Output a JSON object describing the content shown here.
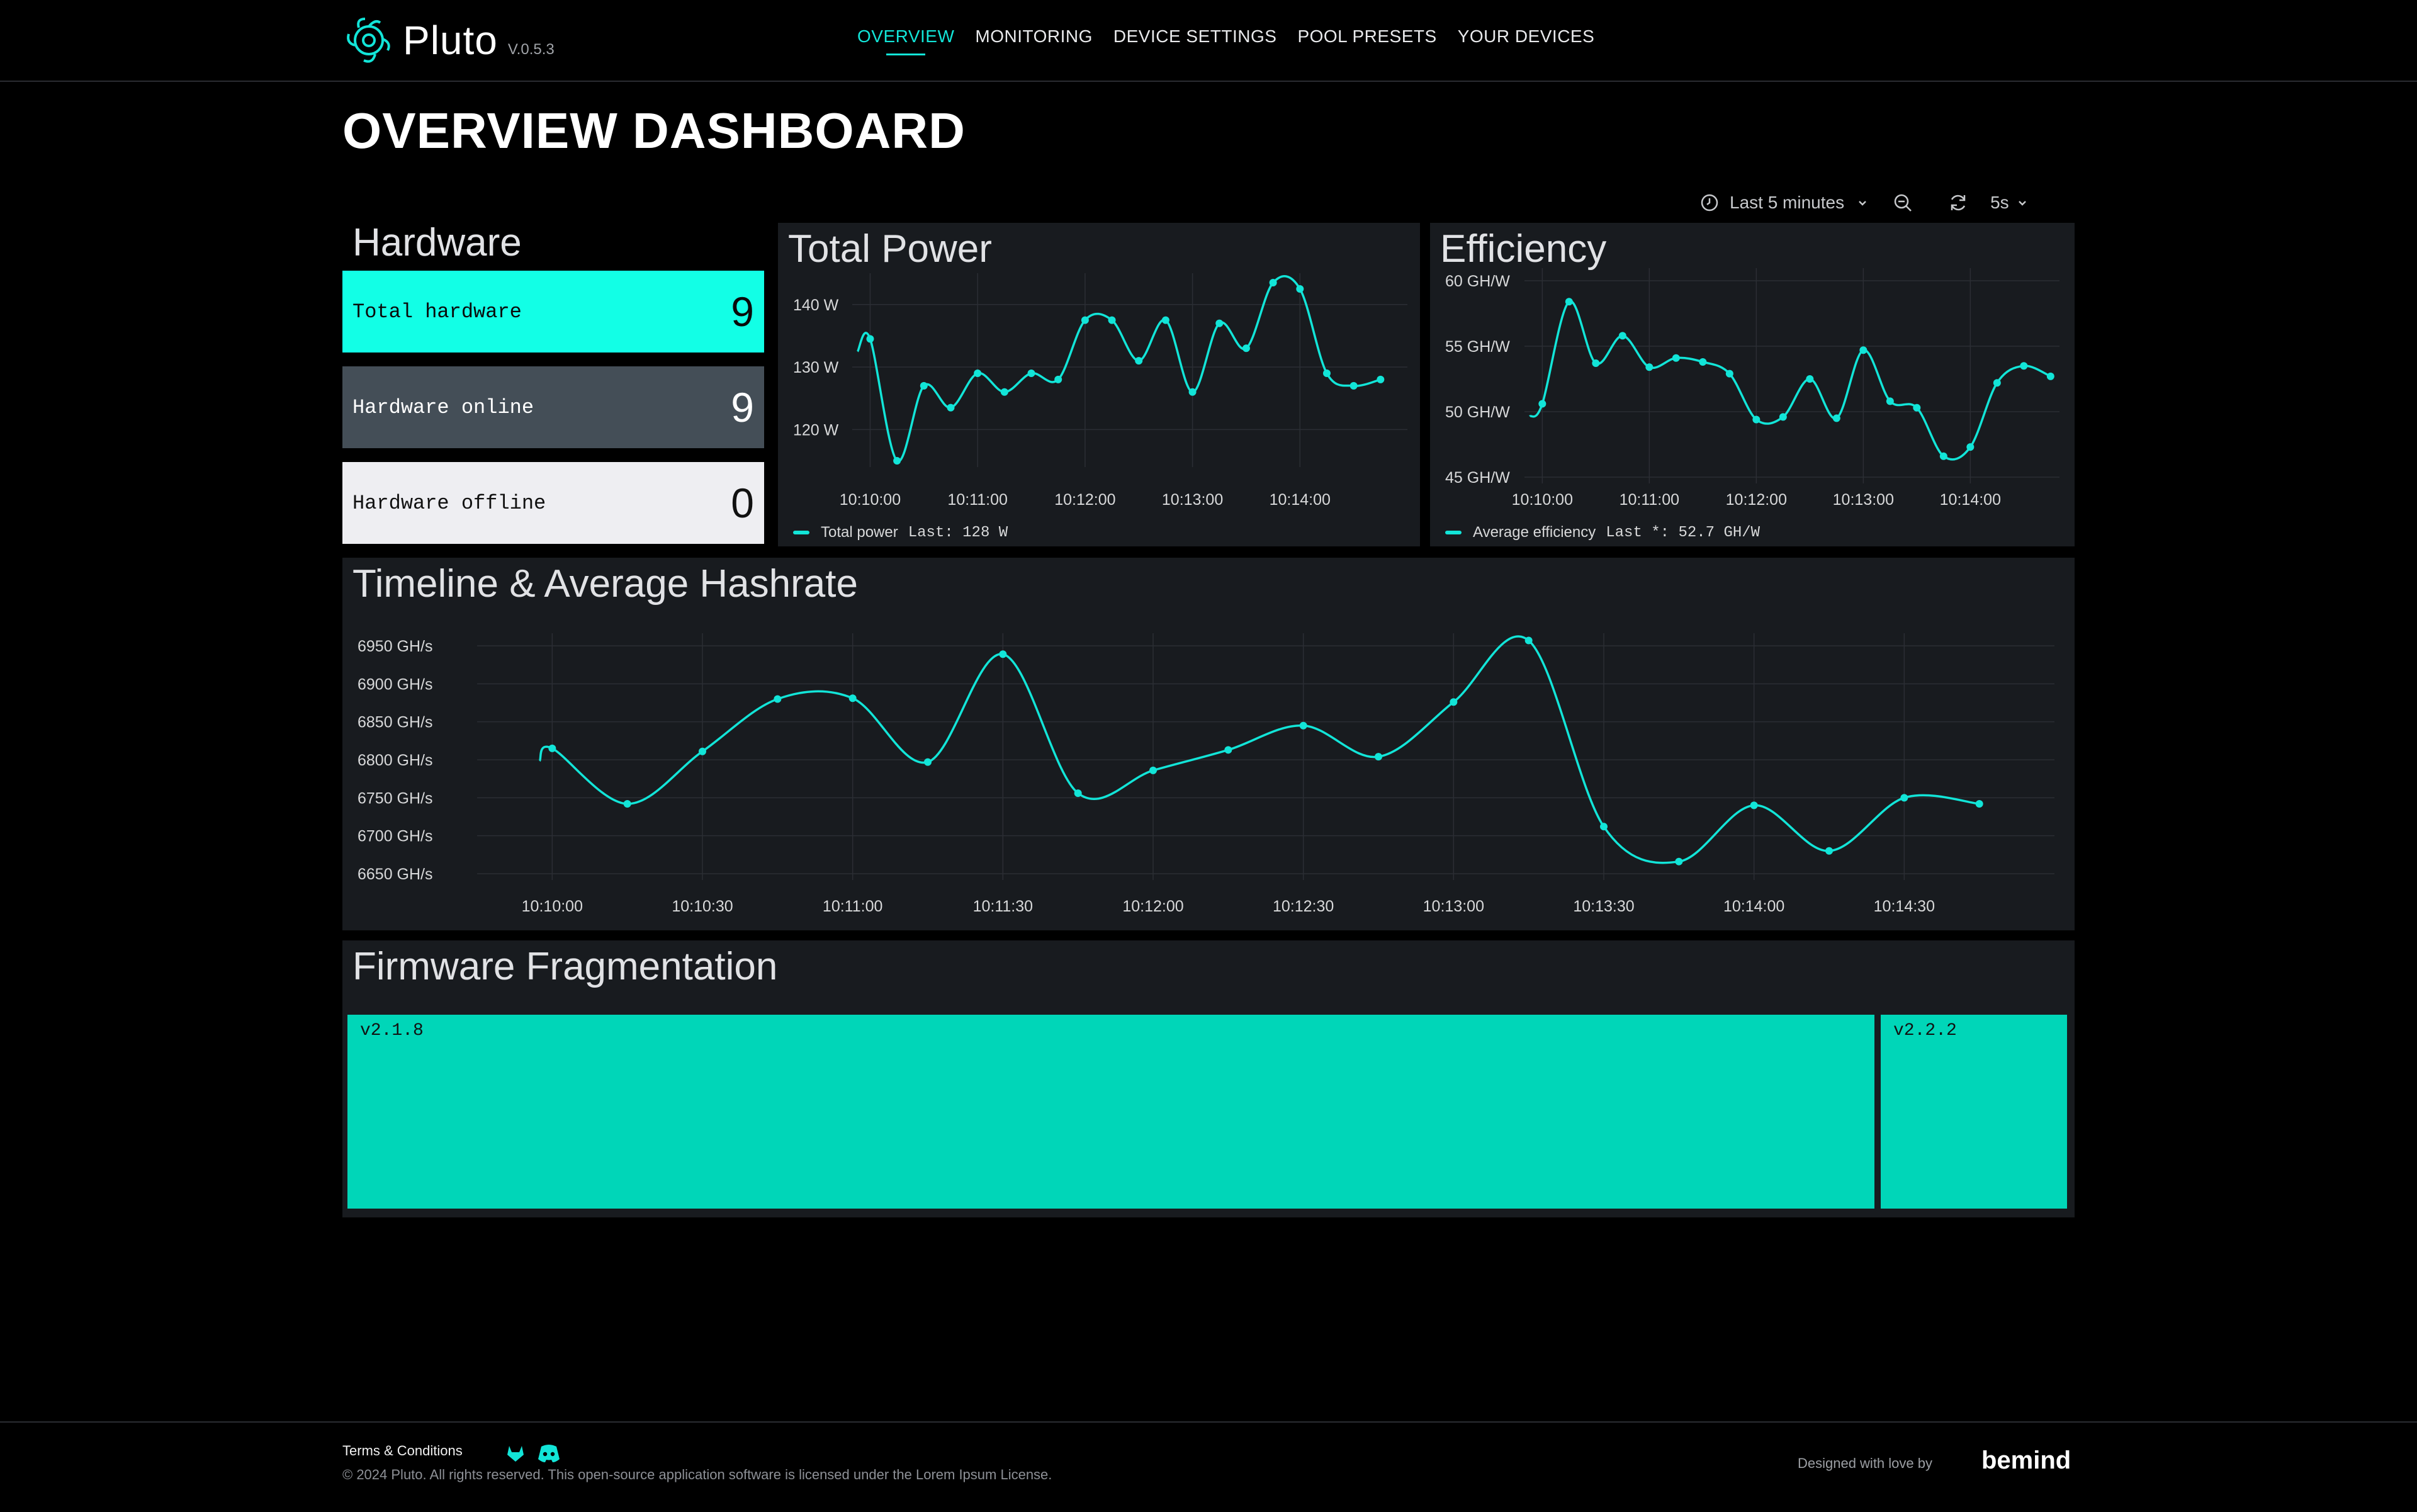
{
  "app": {
    "name": "Pluto",
    "version": "V.0.5.3"
  },
  "nav": [
    "OVERVIEW",
    "MONITORING",
    "DEVICE SETTINGS",
    "POOL PRESETS",
    "YOUR DEVICES"
  ],
  "page_title": "OVERVIEW DASHBOARD",
  "controls": {
    "time_range": "Last 5 minutes",
    "refresh": "5s"
  },
  "hardware": {
    "title": "Hardware",
    "total_label": "Total hardware",
    "total_value": "9",
    "online_label": "Hardware online",
    "online_value": "9",
    "offline_label": "Hardware offline",
    "offline_value": "0"
  },
  "total_power": {
    "title": "Total Power",
    "legend": "Total power",
    "last": "Last: 128 W"
  },
  "efficiency": {
    "title": "Efficiency",
    "legend": "Average efficiency",
    "last": "Last *: 52.7 GH/W"
  },
  "hashrate": {
    "title": "Timeline & Average Hashrate"
  },
  "firmware": {
    "title": "Firmware Fragmentation",
    "v1": "v2.1.8",
    "v2": "v2.2.2"
  },
  "footer": {
    "terms": "Terms & Conditions",
    "copyright": "© 2024 Pluto. All rights reserved. This open-source application software is licensed under the Lorem Ipsum License.",
    "designed": "Designed with love by",
    "brand": "bemind"
  },
  "colors": {
    "accent": "#12e5d8",
    "panel": "#181b1f",
    "firmware": "#00d6b8",
    "online": "#444e57",
    "offline": "#eeeef2"
  },
  "chart_data": [
    {
      "type": "line",
      "title": "Total Power",
      "x_ticks": [
        "10:10:00",
        "10:11:00",
        "10:12:00",
        "10:13:00",
        "10:14:00"
      ],
      "y_ticks": [
        "120 W",
        "130 W",
        "140 W"
      ],
      "ylim": [
        115,
        143
      ],
      "xlim": [
        -10,
        300
      ],
      "series": [
        {
          "name": "Total power",
          "x": [
            0,
            15,
            30,
            45,
            60,
            75,
            90,
            105,
            120,
            135,
            150,
            165,
            180,
            195,
            210,
            225,
            240,
            255,
            270,
            285
          ],
          "values": [
            134.5,
            115,
            127,
            123.5,
            129,
            126,
            129,
            128,
            137.5,
            137.5,
            131,
            137.5,
            126,
            137,
            133,
            143.5,
            142.5,
            129,
            127,
            128
          ]
        }
      ]
    },
    {
      "type": "line",
      "title": "Efficiency",
      "x_ticks": [
        "10:10:00",
        "10:11:00",
        "10:12:00",
        "10:13:00",
        "10:14:00"
      ],
      "y_ticks": [
        "45 GH/W",
        "50 GH/W",
        "55 GH/W",
        "60 GH/W"
      ],
      "ylim": [
        45,
        60
      ],
      "xlim": [
        -10,
        290
      ],
      "series": [
        {
          "name": "Average efficiency",
          "x": [
            0,
            15,
            30,
            45,
            60,
            75,
            90,
            105,
            120,
            135,
            150,
            165,
            180,
            195,
            210,
            225,
            240,
            255,
            270,
            285
          ],
          "values": [
            50.6,
            58.4,
            53.7,
            55.8,
            53.4,
            54.1,
            53.8,
            52.9,
            49.4,
            49.6,
            52.5,
            49.5,
            54.7,
            50.8,
            50.3,
            46.6,
            47.3,
            52.2,
            53.5,
            52.7
          ]
        }
      ]
    },
    {
      "type": "line",
      "title": "Timeline & Average Hashrate",
      "x_ticks": [
        "10:10:00",
        "10:10:30",
        "10:11:00",
        "10:11:30",
        "10:12:00",
        "10:12:30",
        "10:13:00",
        "10:13:30",
        "10:14:00",
        "10:14:30"
      ],
      "y_ticks": [
        "6650 GH/s",
        "6700 GH/s",
        "6750 GH/s",
        "6800 GH/s",
        "6850 GH/s",
        "6900 GH/s",
        "6950 GH/s"
      ],
      "ylim": [
        6650,
        6950
      ],
      "xlim": [
        -15,
        300
      ],
      "series": [
        {
          "name": "Average hashrate",
          "x": [
            0,
            15,
            30,
            45,
            60,
            75,
            90,
            105,
            120,
            135,
            150,
            165,
            180,
            195,
            210,
            225,
            240,
            255,
            270,
            285
          ],
          "values": [
            6815,
            6742,
            6811,
            6880,
            6881,
            6797,
            6939,
            6756,
            6786,
            6813,
            6845,
            6804,
            6876,
            6957,
            6712,
            6666,
            6740,
            6680,
            6750,
            6742
          ]
        }
      ]
    }
  ]
}
